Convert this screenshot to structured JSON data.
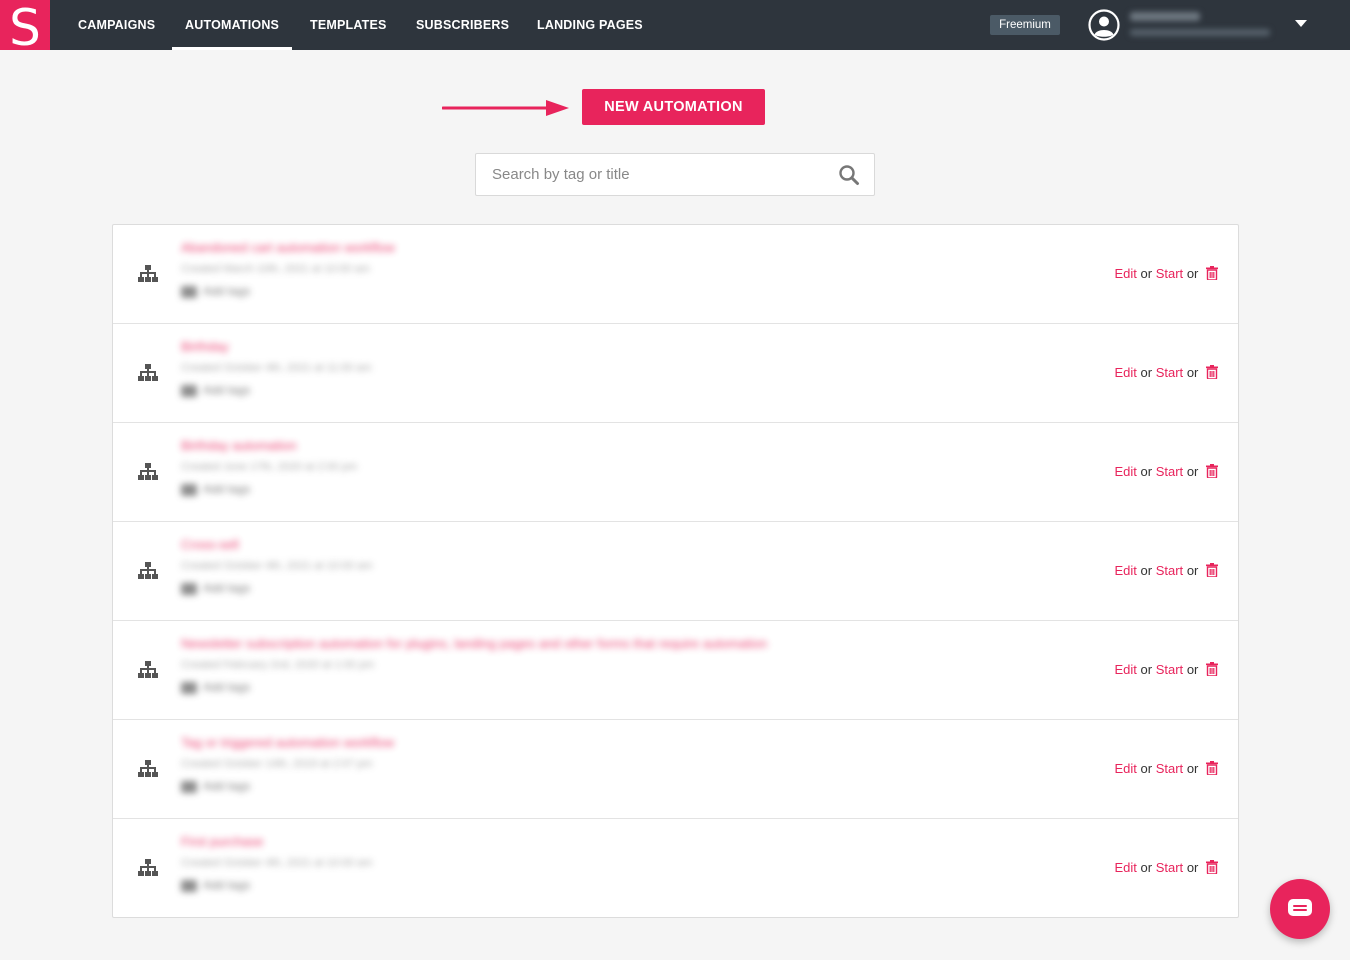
{
  "app": {
    "logo_letter": "S",
    "brand_color": "#e8245c",
    "nav_color": "#2e353d"
  },
  "nav": {
    "items": [
      {
        "label": "CAMPAIGNS",
        "active": false
      },
      {
        "label": "AUTOMATIONS",
        "active": true
      },
      {
        "label": "TEMPLATES",
        "active": false
      },
      {
        "label": "SUBSCRIBERS",
        "active": false
      },
      {
        "label": "LANDING PAGES",
        "active": false
      }
    ],
    "plan_badge": "Freemium",
    "user_icon": "user-circle-icon",
    "dropdown_icon": "caret-down-icon"
  },
  "toolbar": {
    "new_automation_label": "NEW AUTOMATION"
  },
  "search": {
    "placeholder": "Search by tag or title",
    "icon": "search-icon"
  },
  "list": {
    "row_icon": "flow-icon",
    "action_edit": "Edit",
    "action_start": "Start",
    "separator": "or",
    "delete_icon": "trash-icon",
    "rows": [
      {
        "title": "Abandoned cart automation workflow",
        "meta": "Created March 10th, 2021 at 10:00 am",
        "tags": "Add tags"
      },
      {
        "title": "Birthday",
        "meta": "Created October 4th, 2021 at 11:00 am",
        "tags": "Add tags"
      },
      {
        "title": "Birthday automation",
        "meta": "Created June 17th, 2020 at 2:00 pm",
        "tags": "Add tags"
      },
      {
        "title": "Cross-sell",
        "meta": "Created October 4th, 2021 at 10:00 am",
        "tags": "Add tags"
      },
      {
        "title": "Newsletter subscription automation for plugins, landing pages and other forms that require automation",
        "meta": "Created February 2nd, 2020 at 1:00 pm",
        "tags": "Add tags"
      },
      {
        "title": "Tag or triggered automation workflow",
        "meta": "Created October 14th, 2019 at 2:07 pm",
        "tags": "Add tags"
      },
      {
        "title": "First purchase",
        "meta": "Created October 4th, 2021 at 10:00 am",
        "tags": "Add tags"
      }
    ]
  },
  "chat": {
    "icon": "chat-bubble-icon"
  }
}
